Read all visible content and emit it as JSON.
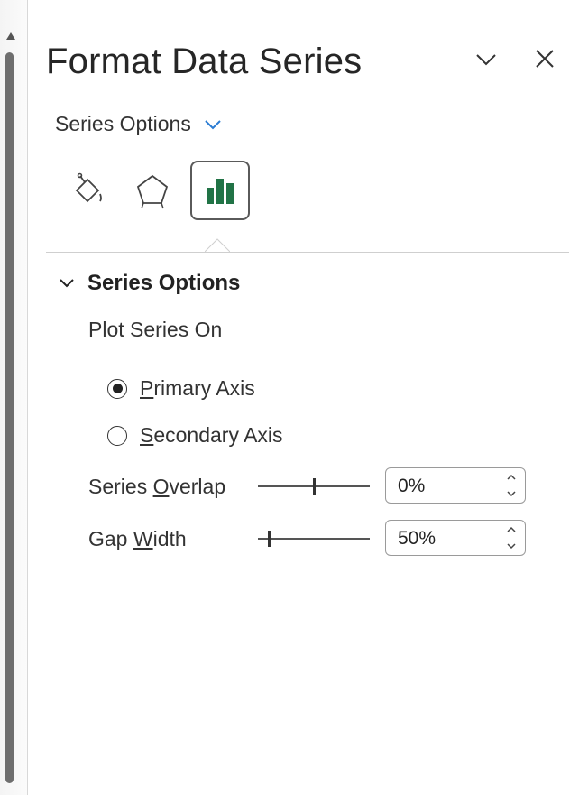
{
  "pane": {
    "title": "Format Data Series",
    "options_dropdown": {
      "label": "Series Options"
    }
  },
  "tabs": [
    {
      "icon": "fill-bucket-icon",
      "active": false
    },
    {
      "icon": "pentagon-effects-icon",
      "active": false
    },
    {
      "icon": "bar-chart-icon",
      "active": true
    }
  ],
  "colors": {
    "accent": "#2b7cd3",
    "bar_icon": "#217346"
  },
  "section": {
    "title": "Series Options",
    "plot_series_on": "Plot Series On",
    "radios": [
      {
        "accel": "P",
        "rest": "rimary Axis",
        "checked": true
      },
      {
        "accel": "S",
        "rest": "econdary Axis",
        "checked": false
      }
    ],
    "overlap": {
      "label_pre": "Series ",
      "label_accel": "O",
      "label_post": "verlap",
      "value": "0%",
      "slider_fraction": 0.5
    },
    "gap": {
      "label_pre": "Gap ",
      "label_accel": "W",
      "label_post": "idth",
      "value": "50%",
      "slider_fraction": 0.1
    }
  }
}
